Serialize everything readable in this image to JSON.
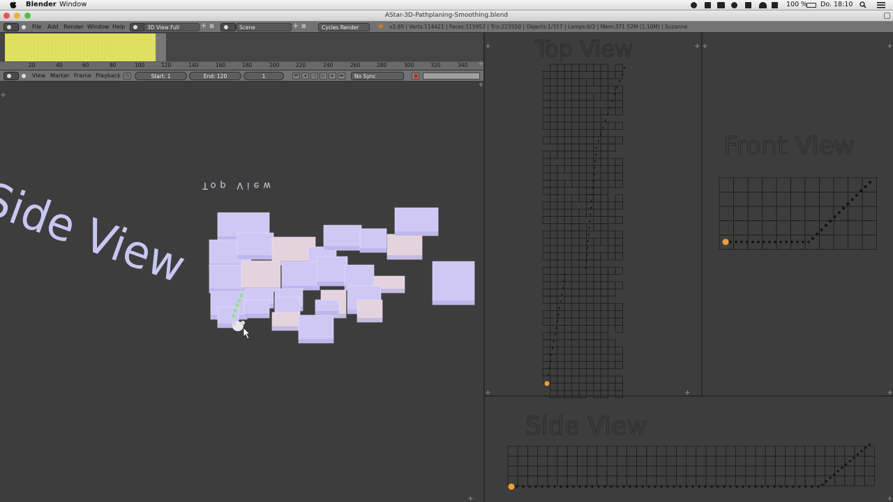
{
  "menubar": {
    "app_name": "Blender",
    "window_menu": "Window",
    "battery": "100 %",
    "clock": "Do. 18:10"
  },
  "window": {
    "title": "AStar-3D-Pathplaning-Smoothing.blend"
  },
  "info_header": {
    "menus": [
      "File",
      "Add",
      "Render",
      "Window",
      "Help"
    ],
    "screen_layout": "3D View Full",
    "scene": "Scene",
    "render_engine": "Cycles Render",
    "stats": "v2.69 | Verts:114421 | Faces:115952 | Tris:223550 | Objects:1/317 | Lamps:0/2 | Mem:371.52M (1.10M) | Suzanne"
  },
  "timeline": {
    "ruler_ticks": [
      "20",
      "40",
      "60",
      "80",
      "100",
      "120",
      "140",
      "160",
      "180",
      "200",
      "220",
      "240",
      "260",
      "280",
      "300",
      "320",
      "340"
    ],
    "menus": [
      "View",
      "Marker",
      "Frame",
      "Playback"
    ],
    "start": "Start: 1",
    "end": "End: 120",
    "current_frame": "1",
    "sync": "No Sync"
  },
  "viewport": {
    "side_view_text": "Side View",
    "top_view_text": "Top View"
  },
  "panels": {
    "top_view_title": "Top View",
    "front_view_title": "Front View",
    "side_view_title": "Side View"
  },
  "colors": {
    "cube_fill": "#cfc8f4",
    "cube_shade": "#b3abe4",
    "grid_line": "#1c1c1c",
    "path_dot": "#111111",
    "start_marker": "#f0a030",
    "timeline_keyframes": "#e0e064"
  }
}
